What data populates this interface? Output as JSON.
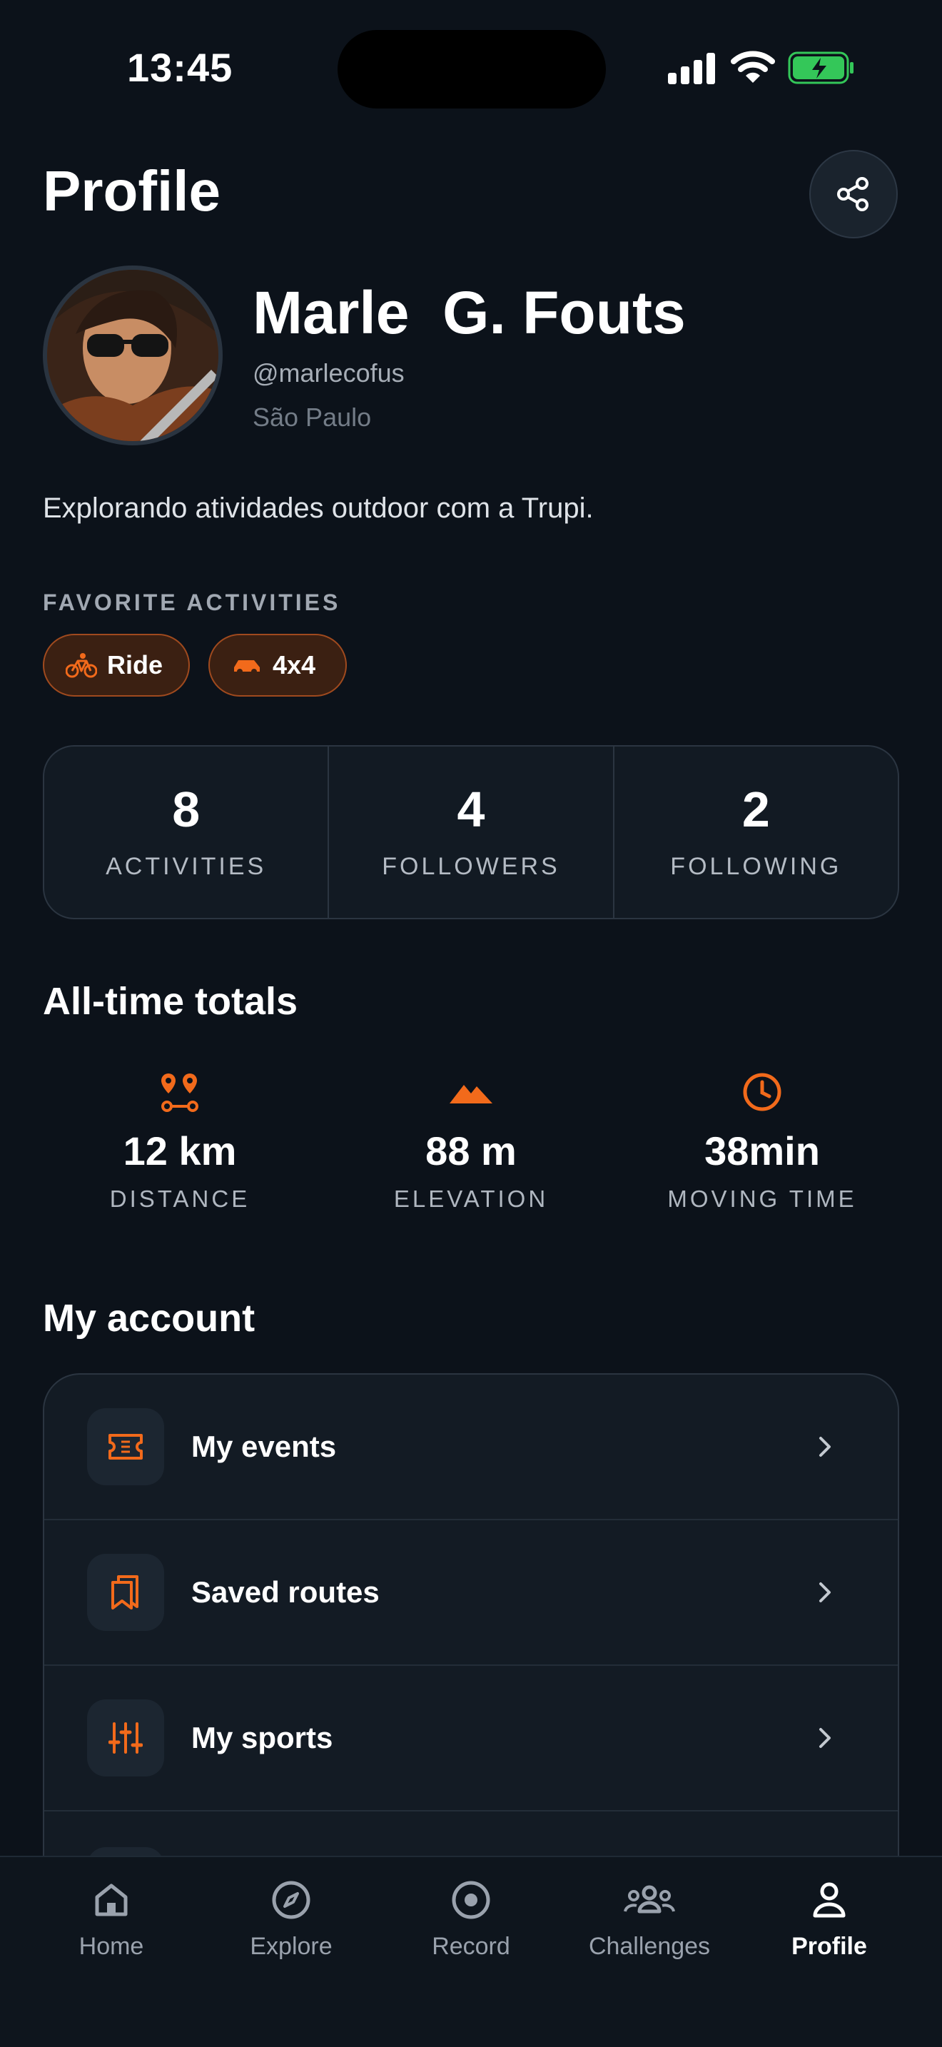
{
  "status_bar": {
    "time": "13:45",
    "signal_icon": "signal-icon",
    "wifi_icon": "wifi-icon",
    "battery_icon": "battery-charging-icon"
  },
  "header": {
    "title": "Profile",
    "share_icon": "share-icon"
  },
  "profile": {
    "name": "Marle  G. Fouts",
    "handle": "@marlecofus",
    "location": "São Paulo",
    "bio": "Explorando atividades outdoor com a Trupi."
  },
  "favorite_activities": {
    "caption": "FAVORITE ACTIVITIES",
    "items": [
      {
        "label": "Ride",
        "icon": "bicycle-icon"
      },
      {
        "label": "4x4",
        "icon": "car-icon"
      }
    ]
  },
  "stats": [
    {
      "value": "8",
      "label": "ACTIVITIES"
    },
    {
      "value": "4",
      "label": "FOLLOWERS"
    },
    {
      "value": "2",
      "label": "FOLLOWING"
    }
  ],
  "totals": {
    "title": "All-time totals",
    "items": [
      {
        "value": "12 km",
        "label": "DISTANCE",
        "icon": "route-pins-icon"
      },
      {
        "value": "88 m",
        "label": "ELEVATION",
        "icon": "mountain-icon"
      },
      {
        "value": "38min",
        "label": "MOVING TIME",
        "icon": "clock-icon"
      }
    ]
  },
  "account": {
    "title": "My account",
    "items": [
      {
        "label": "My events",
        "icon": "ticket-icon"
      },
      {
        "label": "Saved routes",
        "icon": "bookmarks-icon"
      },
      {
        "label": "My sports",
        "icon": "sliders-icon"
      }
    ]
  },
  "tab_bar": {
    "items": [
      {
        "label": "Home",
        "icon": "home-icon"
      },
      {
        "label": "Explore",
        "icon": "compass-icon"
      },
      {
        "label": "Record",
        "icon": "record-icon"
      },
      {
        "label": "Challenges",
        "icon": "group-icon"
      },
      {
        "label": "Profile",
        "icon": "user-icon"
      }
    ],
    "active": "Profile"
  },
  "colors": {
    "background": "#0c121a",
    "accent": "#f26a1b",
    "card": "#131b24",
    "battery_green": "#34c759"
  }
}
